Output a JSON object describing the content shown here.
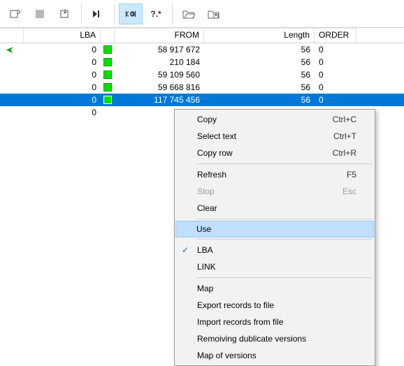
{
  "toolbar": {
    "buttons": [
      "refresh",
      "stop",
      "export",
      "play-to",
      "step-zero",
      "unknown-q",
      "open-folder",
      "save-folder"
    ],
    "active_index": 4
  },
  "grid": {
    "headers": {
      "lba": "LBA",
      "from": "FROM",
      "length": "Length",
      "order": "ORDER"
    },
    "rows": [
      {
        "lba": "0",
        "sq": true,
        "from": "58 917 672",
        "length": "56",
        "order": "0",
        "bookmark": true
      },
      {
        "lba": "0",
        "sq": true,
        "from": "210 184",
        "length": "56",
        "order": "0"
      },
      {
        "lba": "0",
        "sq": true,
        "from": "59 109 560",
        "length": "56",
        "order": "0"
      },
      {
        "lba": "0",
        "sq": true,
        "from": "59 668 816",
        "length": "56",
        "order": "0"
      },
      {
        "lba": "0",
        "sq": true,
        "from": "117 745 456",
        "length": "56",
        "order": "0",
        "selected": true
      },
      {
        "lba": "0",
        "sq": false,
        "from": "",
        "length": "",
        "order": ""
      }
    ]
  },
  "context_menu": {
    "items": [
      {
        "label": "Copy",
        "shortcut": "Ctrl+C"
      },
      {
        "label": "Select text",
        "shortcut": "Ctrl+T"
      },
      {
        "label": "Copy row",
        "shortcut": "Ctrl+R"
      },
      {
        "sep": true
      },
      {
        "label": "Refresh",
        "shortcut": "F5"
      },
      {
        "label": "Stop",
        "shortcut": "Esc",
        "disabled": true
      },
      {
        "label": "Clear"
      },
      {
        "sep": true
      },
      {
        "label": "Use",
        "highlight": true
      },
      {
        "sep": true
      },
      {
        "label": "LBA",
        "checked": true
      },
      {
        "label": "LINK"
      },
      {
        "sep": true
      },
      {
        "label": "Map"
      },
      {
        "label": "Export records to file"
      },
      {
        "label": "Import records from file"
      },
      {
        "label": "Remoiving dublicate versions"
      },
      {
        "label": "Map of versions"
      }
    ]
  }
}
